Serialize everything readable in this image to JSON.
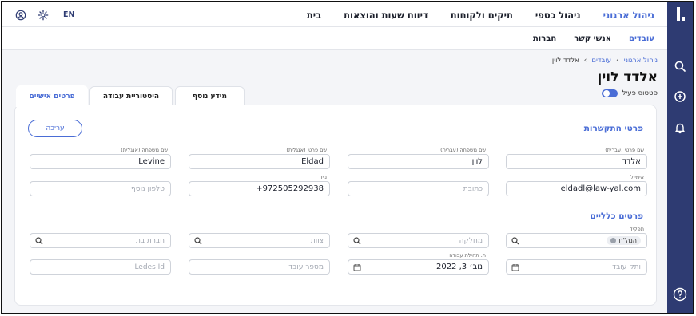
{
  "topnav": {
    "items": [
      {
        "label": "בית"
      },
      {
        "label": "דיווח שעות והוצאות"
      },
      {
        "label": "תיקים ולקוחות"
      },
      {
        "label": "ניהול כספי"
      },
      {
        "label": "ניהול ארגוני"
      }
    ],
    "language": "EN"
  },
  "subnav": {
    "items": [
      {
        "label": "עובדים"
      },
      {
        "label": "אנשי קשר"
      },
      {
        "label": "חברות"
      }
    ]
  },
  "breadcrumb": {
    "root": "ניהול ארגוני",
    "parent": "עובדים",
    "current": "אלדד לוין"
  },
  "page": {
    "title": "אלדד לוין",
    "status_label": "סטטוס פעיל"
  },
  "tabs": [
    {
      "label": "פרטים אישיים"
    },
    {
      "label": "היסטוריית עבודה"
    },
    {
      "label": "מידע נוסף"
    }
  ],
  "edit_label": "עריכה",
  "contact_section": {
    "title": "פרטי התקשרות",
    "first_name_he": {
      "label": "שם פרטי (עברית)",
      "value": "אלדד"
    },
    "last_name_he": {
      "label": "שם משפחה (עברית)",
      "value": "לוין"
    },
    "first_name_en": {
      "label": "שם פרטי (אנגלית)",
      "value": "Eldad"
    },
    "last_name_en": {
      "label": "שם משפחה (אנגלית)",
      "value": "Levine"
    },
    "email": {
      "label": "אימייל",
      "value": "eldadl@law-yal.com"
    },
    "address": {
      "placeholder": "כתובת"
    },
    "mobile": {
      "label": "נייד",
      "value": "+972505292938"
    },
    "extra_phone": {
      "placeholder": "טלפון נוסף"
    }
  },
  "general_section": {
    "title": "פרטים כלליים",
    "role": {
      "label": "תפקיד",
      "chip": "הנה\"ח"
    },
    "department": {
      "placeholder": "מחלקה"
    },
    "team": {
      "placeholder": "צוות"
    },
    "subsidiary": {
      "placeholder": "חברת בת"
    },
    "seniority": {
      "placeholder": "ותק עובד"
    },
    "start_date": {
      "label": "ת. תחילת עבודה",
      "value": "נוב׳ 3, 2022"
    },
    "employee_number": {
      "placeholder": "מספר עובד"
    },
    "ledes_id": {
      "placeholder": "Ledes Id"
    }
  }
}
